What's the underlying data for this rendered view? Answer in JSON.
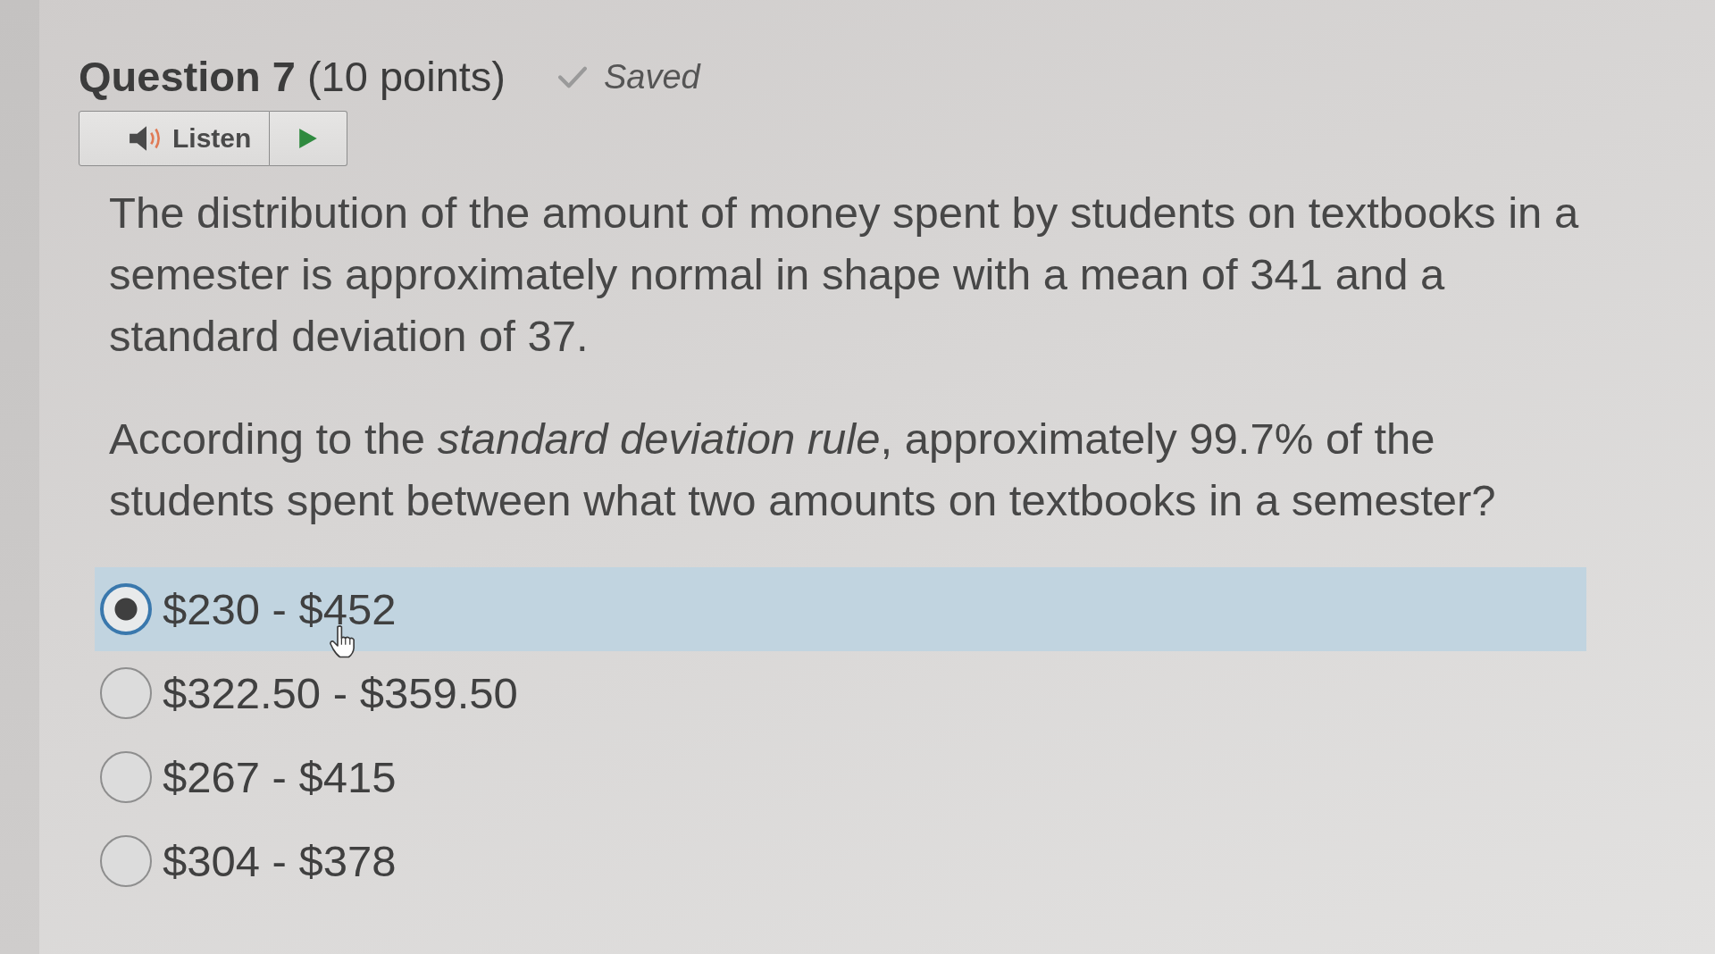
{
  "question": {
    "title": "**Question 7** (10 points)",
    "save_status": "Saved"
  },
  "listen": {
    "label": "Listen"
  },
  "stem": [
    "The distribution of the amount of money spent by students on textbooks in a semester is approximately normal in shape with a mean of 341 and a standard deviation of 37.",
    "According to the *standard deviation rule*, approximately 99.7% of the students spent between what two amounts on textbooks in a semester?"
  ],
  "options": [
    {
      "label": "$230 - $452",
      "selected": true
    },
    {
      "label": "$322.50 - $359.50",
      "selected": false
    },
    {
      "label": "$267 - $415",
      "selected": false
    },
    {
      "label": "$304 - $378",
      "selected": false
    }
  ]
}
